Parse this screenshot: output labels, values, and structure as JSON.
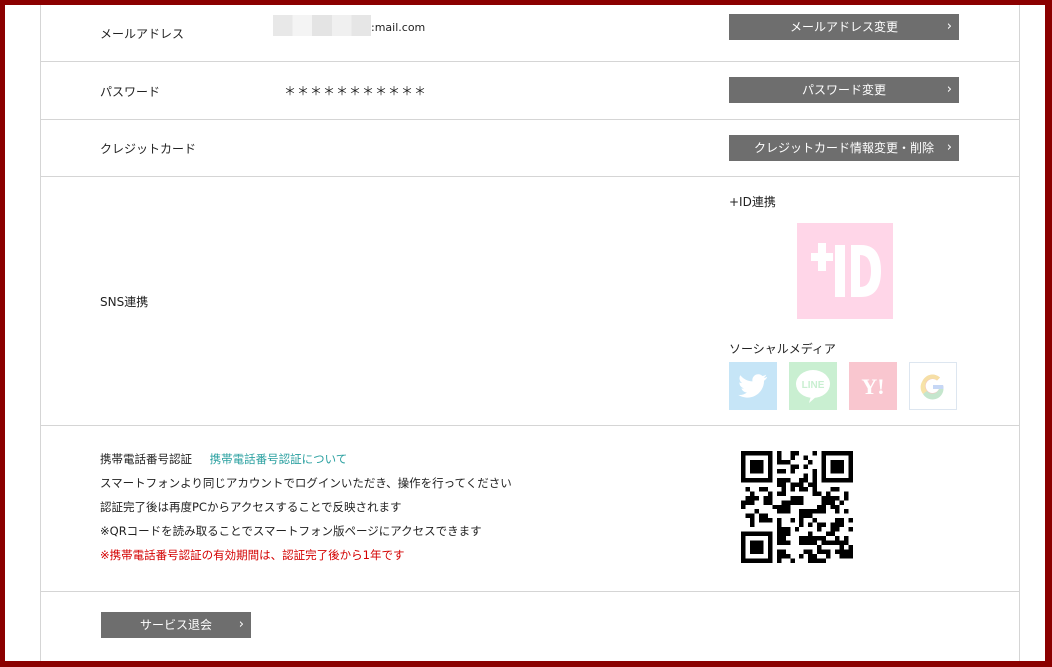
{
  "account": {
    "email": {
      "label": "メールアドレス",
      "value_suffix": "mail.com",
      "button": "メールアドレス変更"
    },
    "password": {
      "label": "パスワード",
      "value": "＊＊＊＊＊＊＊＊＊＊＊",
      "button": "パスワード変更"
    },
    "credit_card": {
      "label": "クレジットカード",
      "button": "クレジットカード情報変更・削除"
    },
    "sns": {
      "label": "SNS連携",
      "tid_title": "+ID連携",
      "social_title": "ソーシャルメディア",
      "social_icons": [
        "twitter-icon",
        "line-icon",
        "yahoo-icon",
        "google-icon"
      ]
    },
    "phone": {
      "label": "携帯電話番号認証",
      "link": "携帯電話番号認証について",
      "line1": "スマートフォンより同じアカウントでログインいただき、操作を行ってください",
      "line2": "認証完了後は再度PCからアクセスすることで反映されます",
      "line3": "※QRコードを読み取ることでスマートフォン版ページにアクセスできます",
      "line4_warning": "※携帯電話番号認証の有効期間は、認証完了後から1年です"
    },
    "withdraw": {
      "button": "サービス退会"
    }
  },
  "colors": {
    "frame": "#8b0000",
    "button_bg": "#6e6e6e",
    "link": "#2aa0a0",
    "warning": "#d40000",
    "tid_pink": "#ffd6e8",
    "twitter": "#c6e5f7",
    "line": "#c9efd1",
    "yahoo": "#f9c6cf"
  }
}
